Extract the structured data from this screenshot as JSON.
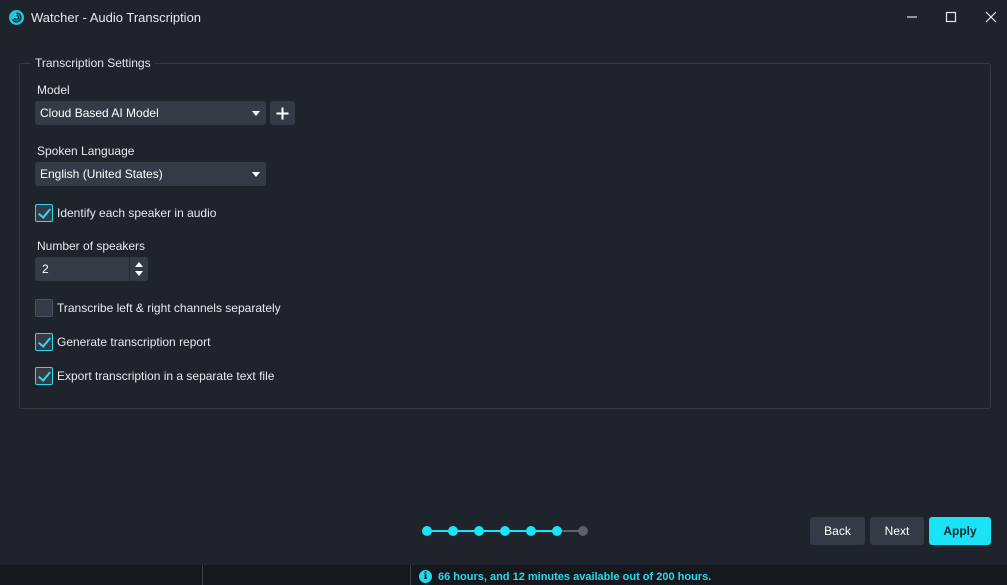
{
  "window": {
    "title": "Watcher - Audio Transcription",
    "app_icon": "watcher-logo-icon",
    "controls": [
      "minimize-icon",
      "maximize-icon",
      "close-icon"
    ]
  },
  "settings": {
    "group_title": "Transcription Settings",
    "model": {
      "label": "Model",
      "selected": "Cloud Based AI Model"
    },
    "language": {
      "label": "Spoken Language",
      "selected": "English (United States)"
    },
    "identify_speakers": {
      "label": "Identify each speaker in audio",
      "checked": true
    },
    "speaker_count": {
      "label": "Number of speakers",
      "value": "2"
    },
    "separate_channels": {
      "label": "Transcribe left & right channels separately",
      "checked": false
    },
    "generate_report": {
      "label": "Generate transcription report",
      "checked": true
    },
    "export_text": {
      "label": "Export transcription in a separate text file",
      "checked": true
    }
  },
  "wizard": {
    "steps_total": 7,
    "current_step": 6,
    "active_color": "#19e3f5",
    "inactive_color": "#5b606a"
  },
  "footer": {
    "back_label": "Back",
    "next_label": "Next",
    "apply_label": "Apply"
  },
  "status": {
    "info_icon": "info-icon",
    "message": "66 hours, and 12 minutes available out of 200 hours."
  },
  "colors": {
    "accent": "#19e3f5",
    "background": "#1f232b",
    "control": "#353b46"
  }
}
